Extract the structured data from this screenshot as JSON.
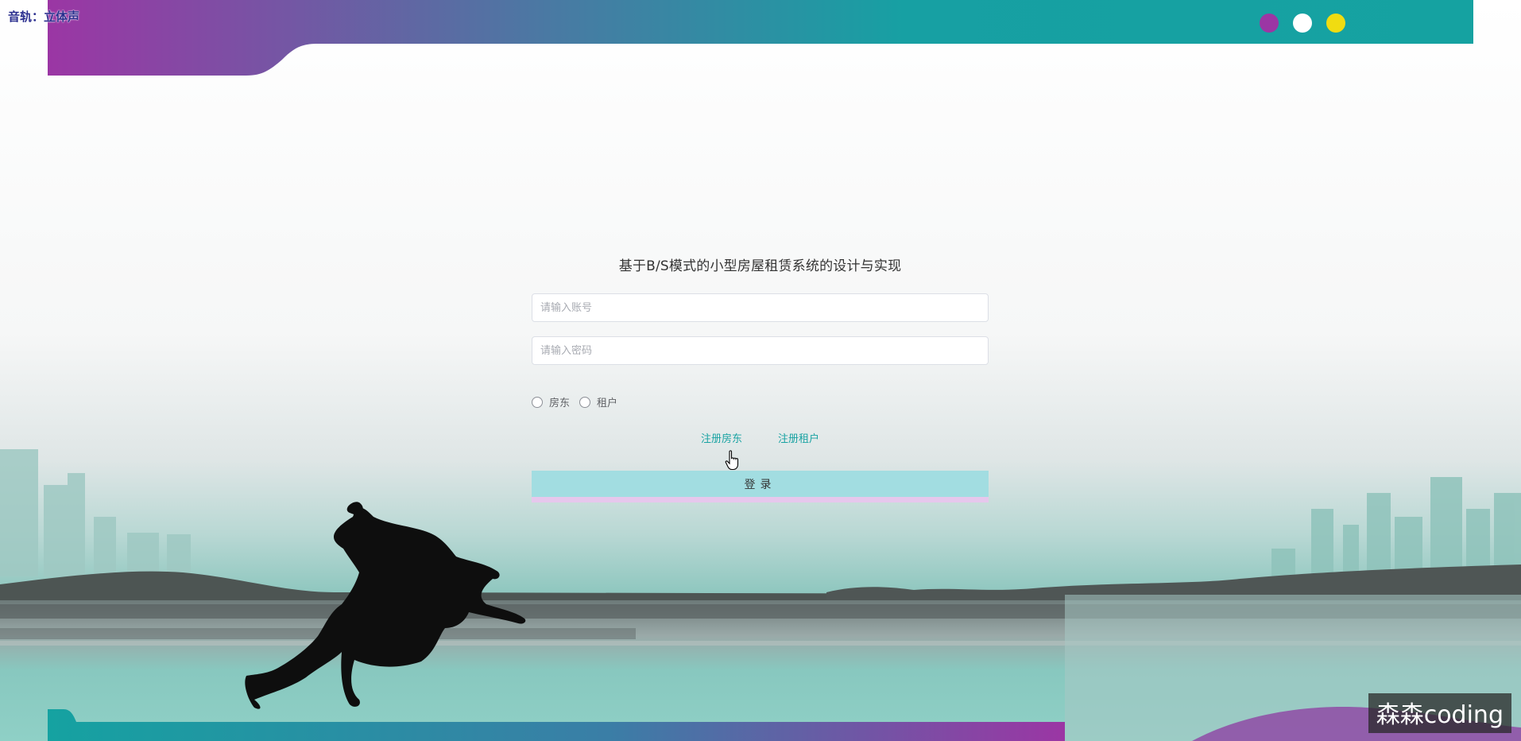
{
  "overlay": {
    "text": "音轨：立体声"
  },
  "header_dots": {
    "colors": [
      "#9b36a4",
      "#ffffff",
      "#f0dc11"
    ]
  },
  "login": {
    "title": "基于B/S模式的小型房屋租赁系统的设计与实现",
    "username_placeholder": "请输入账号",
    "password_placeholder": "请输入密码",
    "roles": [
      {
        "label": "房东"
      },
      {
        "label": "租户"
      }
    ],
    "register_landlord": "注册房东",
    "register_tenant": "注册租户",
    "submit_label": "登录"
  },
  "watermark": {
    "text": "森森coding"
  },
  "colors": {
    "accent_teal": "#1aa3a3",
    "button_bg": "#a2dde1",
    "header_purple": "#9b36a4"
  }
}
